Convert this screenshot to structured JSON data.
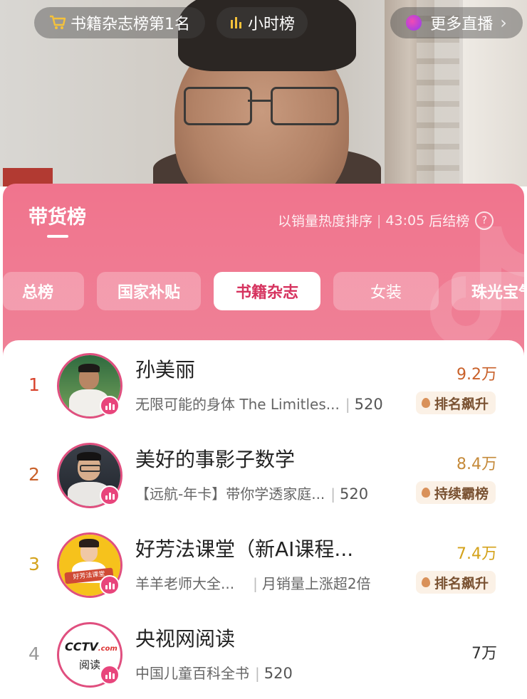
{
  "top_bar": {
    "rank_pill": "书籍杂志榜第1名",
    "hourly_pill": "小时榜",
    "more_live": "更多直播",
    "chevron": "›"
  },
  "panel": {
    "title": "带货榜",
    "sort_info": "以销量热度排序",
    "countdown": "43:05",
    "countdown_suffix": "后结榜",
    "help": "?",
    "tabs": [
      "总榜",
      "国家补贴",
      "书籍杂志",
      "女装",
      "珠光宝气"
    ],
    "active_tab": "书籍杂志"
  },
  "rows": [
    {
      "rank": "1",
      "name": "孙美丽",
      "product": "无限可能的身体 The Limitles...",
      "note": "520",
      "amount": "9.2万",
      "badge": "排名飙升"
    },
    {
      "rank": "2",
      "name": "美好的事影子数学",
      "product": "【远航-年卡】带你学透家庭...",
      "note": "520",
      "amount": "8.4万",
      "badge": "持续霸榜"
    },
    {
      "rank": "3",
      "name": "好芳法课堂（新AI课程...",
      "product": "羊羊老师大全...",
      "note": "月销量上涨超2倍",
      "amount": "7.4万",
      "badge": "排名飙升"
    },
    {
      "rank": "4",
      "name": "央视网阅读",
      "product": "中国儿童百科全书",
      "note": "520",
      "amount": "7万",
      "badge": ""
    }
  ],
  "avatar_texts": {
    "row3": "好芳法课堂",
    "row4_logo": "CCTV",
    "row4_com": ".com",
    "row4_read": "阅读"
  },
  "colors": {
    "rank1": "#d8432c",
    "rank2": "#c9612a",
    "rank3": "#d4a21a",
    "rank4": "#999999",
    "amount1": "#c9612a",
    "amount2": "#c58a3a",
    "amount3": "#d4a21a",
    "amount4": "#333333",
    "accent": "#e8457c"
  }
}
